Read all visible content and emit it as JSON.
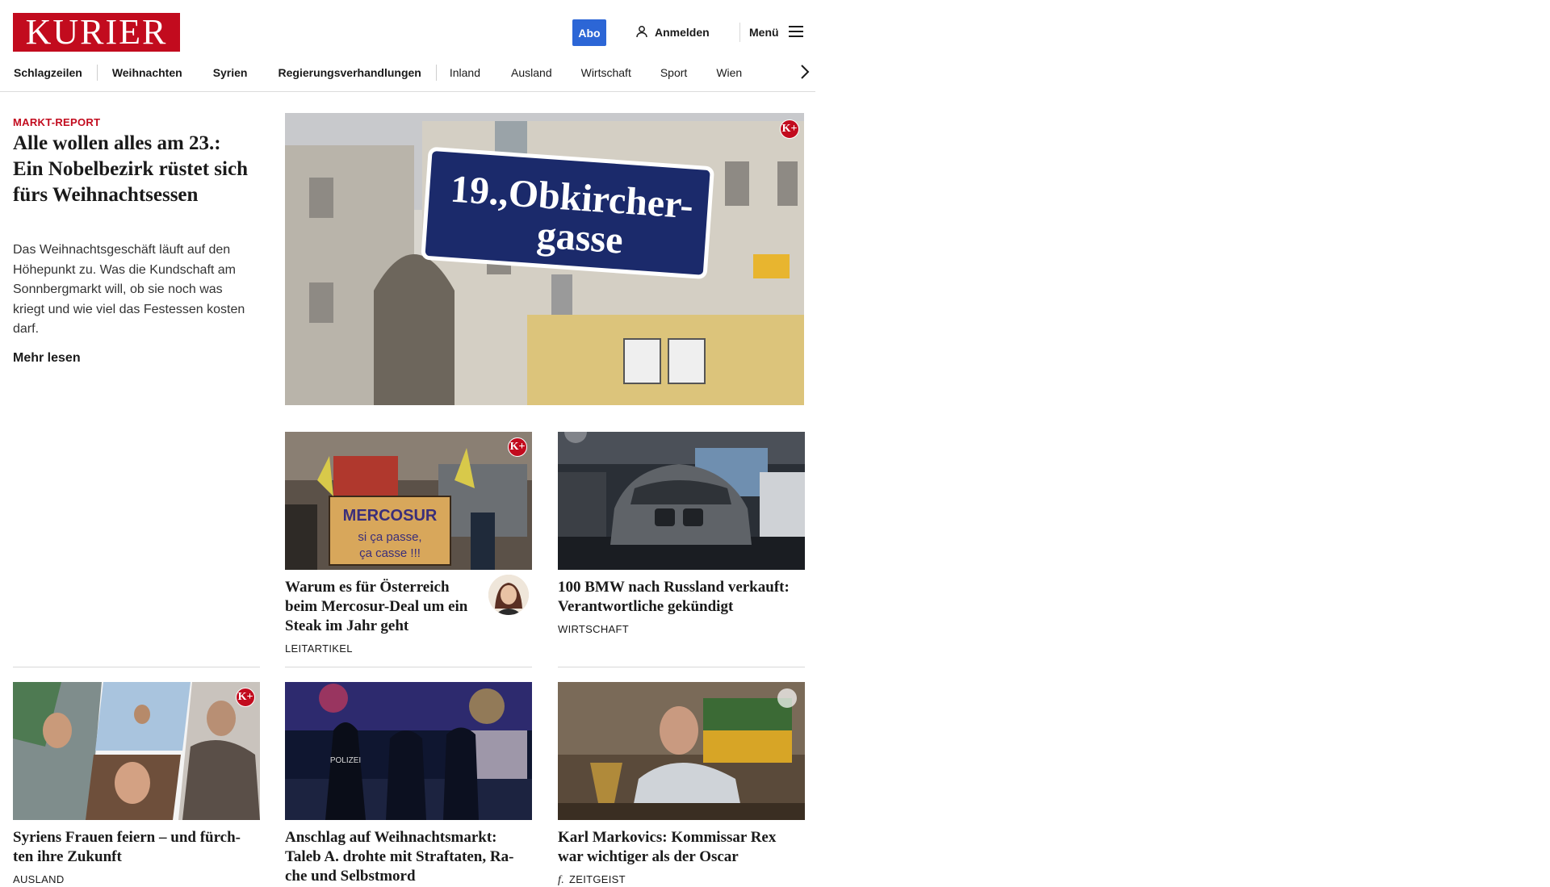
{
  "header": {
    "logo_text": "KURIER",
    "abo_label": "Abo",
    "login_label": "Anmelden",
    "menu_label": "Menü"
  },
  "nav": {
    "items": [
      "Schlagzeilen",
      "Weihnachten",
      "Syrien",
      "Regierungsverhandlungen",
      "Inland",
      "Ausland",
      "Wirtschaft",
      "Sport",
      "Wien"
    ]
  },
  "lead": {
    "kicker": "MARKT-REPORT",
    "title": "Alle wollen alles am 23.: Ein Nobelbezirk rüstet sich fürs Weihnachtsessen",
    "teaser": "Das Weihnachtsgeschäft läuft auf den Höhepunkt zu. Was die Kundschaft am Sonnbergmarkt will, ob sie noch was kriegt und wie viel das Festessen kosten darf.",
    "more_label": "Mehr lesen",
    "image_sign_line1": "19.,Obkircher-",
    "image_sign_line2": "gasse",
    "premium_badge": "K+"
  },
  "cards": [
    {
      "title": "Warum es für Österreich beim Mercosur-Deal um ein Steak im Jahr geht",
      "category": "LEITARTIKEL",
      "premium_badge": "K+",
      "image_sign_text": "MERCOSUR si ça passe, ça casse !!!"
    },
    {
      "title": "100 BMW nach Russland verkauft: Verantwortliche gekündigt",
      "category": "WIRTSCHAFT"
    },
    {
      "title": "Syriens Frauen feiern – und fürch-ten ihre Zukunft",
      "category": "AUSLAND",
      "premium_badge": "K+"
    },
    {
      "title": "Anschlag auf Weihnachtsmarkt: Taleb A. drohte mit Straftaten, Ra-che und Selbstmord",
      "category": "",
      "image_sign_text": "POLIZEI"
    },
    {
      "title": "Karl Markovics: Kommissar Rex war wichtiger als der Oscar",
      "category": "ZEITGEIST",
      "category_icon": "f."
    }
  ],
  "colors": {
    "brand_red": "#c20b1e",
    "abo_blue": "#2c66d6"
  }
}
